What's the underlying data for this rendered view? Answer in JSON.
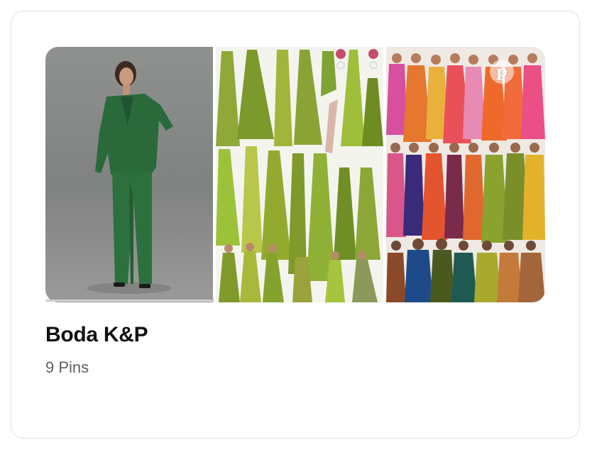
{
  "board": {
    "title": "Boda K&P",
    "pin_count": "9 Pins"
  },
  "collage": {
    "images": [
      {
        "name": "green-satin-suit-photo",
        "accent": "#2f6b3b"
      },
      {
        "name": "olive-dresses-collage",
        "accent": "#8aa52b"
      },
      {
        "name": "colorful-bridesmaid-dresses-collage",
        "accent": "#e07a2f"
      }
    ],
    "badge_icon": "pinterest-icon",
    "badge_glyph": "p"
  },
  "colors": {
    "title": "#111111",
    "subtitle": "#5f5f5f",
    "card_border": "#e2e2e2"
  }
}
